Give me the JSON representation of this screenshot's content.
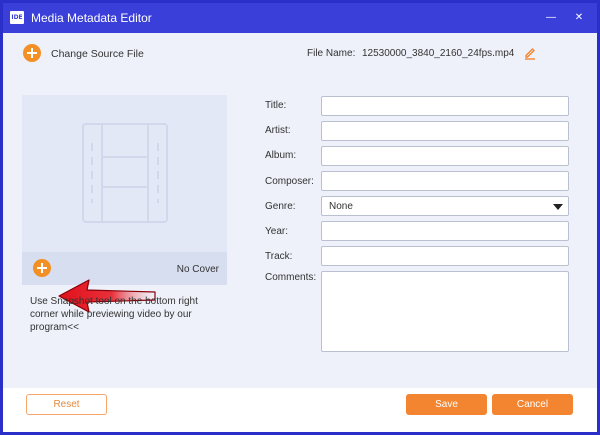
{
  "window": {
    "app_icon_text": "IDE",
    "title": "Media Metadata Editor",
    "minimize_glyph": "—",
    "close_glyph": "✕"
  },
  "header": {
    "change_source_label": "Change Source File",
    "file_name_label": "File Name:",
    "file_name_value": "12530000_3840_2160_24fps.mp4",
    "edit_icon": "pencil-icon"
  },
  "cover": {
    "placeholder_icon": "film-strip-icon",
    "add_icon": "plus-circle-icon",
    "no_cover_text": "No Cover",
    "hint": "Use Snapshot tool on the bottom right corner while previewing video by our program<<"
  },
  "annotation": {
    "arrow_icon": "red-arrow-icon"
  },
  "form": {
    "title_label": "Title:",
    "title_value": "",
    "artist_label": "Artist:",
    "artist_value": "",
    "album_label": "Album:",
    "album_value": "",
    "composer_label": "Composer:",
    "composer_value": "",
    "genre_label": "Genre:",
    "genre_value": "None",
    "year_label": "Year:",
    "year_value": "",
    "track_label": "Track:",
    "track_value": "",
    "comments_label": "Comments:",
    "comments_value": ""
  },
  "footer": {
    "reset_label": "Reset",
    "save_label": "Save",
    "cancel_label": "Cancel"
  },
  "colors": {
    "titlebar": "#3b3fd9",
    "accent": "#f48530",
    "content_bg": "#eef1f9"
  }
}
